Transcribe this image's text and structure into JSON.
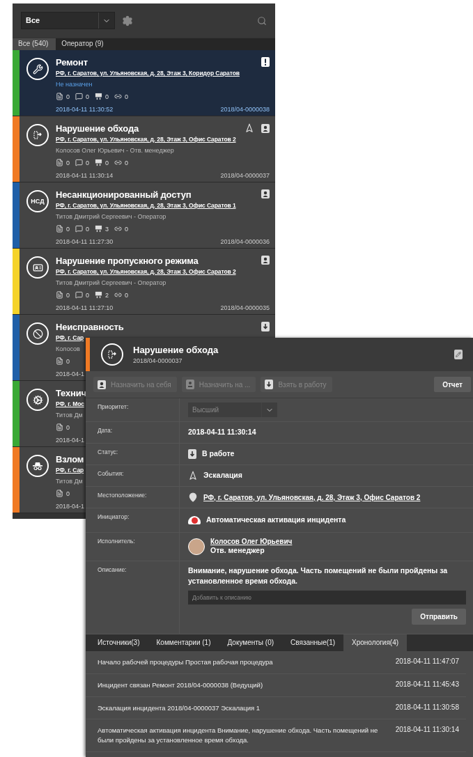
{
  "filter": {
    "value": "Все"
  },
  "tabs": [
    {
      "label": "Все (540)",
      "selected": true
    },
    {
      "label": "Оператор (9)",
      "selected": false
    }
  ],
  "incidents": [
    {
      "title": "Ремонт",
      "address": "РФ, г. Саратов, ул. Ульяновская, д. 28, Этаж 3, Коридор Саратов",
      "person": "Не назначен",
      "assigned": false,
      "counts": [
        "0",
        "0",
        "0",
        "0"
      ],
      "date": "2018-04-11 11:30:52",
      "number": "2018/04-0000038",
      "color": "#3aa935",
      "selected": true,
      "kind": "repair",
      "badges": [
        {
          "kind": "alert"
        }
      ]
    },
    {
      "title": "Нарушение обхода",
      "address": "РФ, г. Саратов, ул. Ульяновская, д. 28, Этаж 3, Офис Саратов 2",
      "person": "Колосов Олег Юрьевич - Отв. менеджер",
      "assigned": true,
      "counts": [
        "0",
        "0",
        "0",
        "0"
      ],
      "date": "2018-04-11 11:30:14",
      "number": "2018/04-0000037",
      "color": "#f07a24",
      "selected": false,
      "kind": "route",
      "badges": [
        {
          "kind": "escalation"
        },
        {
          "kind": "person"
        }
      ]
    },
    {
      "title": "Несанкционированный доступ",
      "address": "РФ, г. Саратов, ул. Ульяновская, д. 28, Этаж 3, Офис Саратов 1",
      "person": "Титов Дмитрий Сергеевич - Оператор",
      "assigned": true,
      "counts": [
        "0",
        "0",
        "3",
        "0"
      ],
      "date": "2018-04-11 11:27:30",
      "number": "2018/04-0000036",
      "color": "#1f5fa8",
      "selected": false,
      "kind": "access",
      "icon_text": "НСД",
      "badges": [
        {
          "kind": "person"
        }
      ]
    },
    {
      "title": "Нарушение пропускного режима",
      "address": "РФ, г. Саратов, ул. Ульяновская, д. 28, Этаж 3, Офис Саратов 2",
      "person": "Титов Дмитрий Сергеевич - Оператор",
      "assigned": true,
      "counts": [
        "0",
        "0",
        "2",
        "0"
      ],
      "date": "2018-04-11 11:27:10",
      "number": "2018/04-0000035",
      "color": "#f5d32a",
      "selected": false,
      "kind": "pass",
      "badges": [
        {
          "kind": "person"
        }
      ]
    },
    {
      "title": "Неисправность",
      "address": "РФ, г. Сар",
      "person": "Колосов",
      "assigned": true,
      "counts": [
        "0"
      ],
      "date": "2018-04-1",
      "color": "#1f5fa8",
      "selected": false,
      "kind": "fault",
      "badges": [
        {
          "kind": "download"
        }
      ]
    },
    {
      "title": "Технич",
      "address": "РФ, г. Мос",
      "person": "Титов Дм",
      "assigned": true,
      "counts": [
        "0"
      ],
      "date": "2018-04-1",
      "color": "#3aa935",
      "selected": false,
      "kind": "tech"
    },
    {
      "title": "Взлом",
      "address": "РФ, г. Сар",
      "person": "Титов Дм",
      "assigned": true,
      "counts": [
        "0"
      ],
      "date": "2018-04-1",
      "color": "#f07a24",
      "selected": false,
      "kind": "breach"
    }
  ],
  "detail": {
    "title": "Нарушение обхода",
    "number": "2018/04-0000037",
    "color": "#f07a24",
    "kind": "route",
    "actions": [
      {
        "label": "Назначить на себя",
        "kind": "assign_self",
        "disabled": true
      },
      {
        "label": "Назначить на ...",
        "kind": "assign",
        "disabled": true
      },
      {
        "label": "Взять в работу",
        "kind": "take",
        "disabled": true
      }
    ],
    "report": "Отчет",
    "fields": [
      {
        "kind": "select",
        "label": "Приоритет:",
        "value": "Высший",
        "disabled": true
      },
      {
        "kind": "text",
        "label": "Дата:",
        "value": "2018-04-11 11:30:14"
      },
      {
        "kind": "status",
        "label": "Статус:",
        "value": "В работе"
      },
      {
        "kind": "event",
        "label": "События:",
        "value": "Эскалация"
      },
      {
        "kind": "location",
        "label": "Местоположение:",
        "value": "РФ, г. Саратов, ул. Ульяновская, д. 28, Этаж 3, Офис Саратов 2"
      },
      {
        "kind": "initiator",
        "label": "Инициатор:",
        "value": "Автоматическая активация инцидента"
      },
      {
        "kind": "person",
        "label": "Исполнитель:",
        "value": "Колосов Олег Юрьевич",
        "role": "Отв. менеджер"
      },
      {
        "kind": "description",
        "label": "Описание:",
        "value": "Внимание, нарушение обхода. Часть помещений не были пройдены за установленное время обхода.",
        "placeholder": "Добавить к описанию",
        "button": "Отправить"
      }
    ],
    "tabs": [
      {
        "label": "Источники(3)",
        "selected": false
      },
      {
        "label": "Комментарии (1)",
        "selected": false
      },
      {
        "label": "Документы (0)",
        "selected": false
      },
      {
        "label": "Связанные(1)",
        "selected": false
      },
      {
        "label": "Хронология(4)",
        "selected": true
      }
    ],
    "timeline": [
      {
        "text": "Начало рабочей процедуры Простая рабочая процедура",
        "time": "2018-04-11 11:47:07"
      },
      {
        "text": "Инцидент связан Ремонт 2018/04-0000038 (Ведущий)",
        "time": "2018-04-11 11:45:43"
      },
      {
        "text": "Эскалация инцидента 2018/04-0000037 Эскалация 1",
        "time": "2018-04-11 11:30:58"
      },
      {
        "text": "Автоматическая активация инцидента Внимание, нарушение обхода. Часть помещений не были пройдены за установленное время обхода.",
        "time": "2018-04-11 11:30:14"
      }
    ]
  }
}
